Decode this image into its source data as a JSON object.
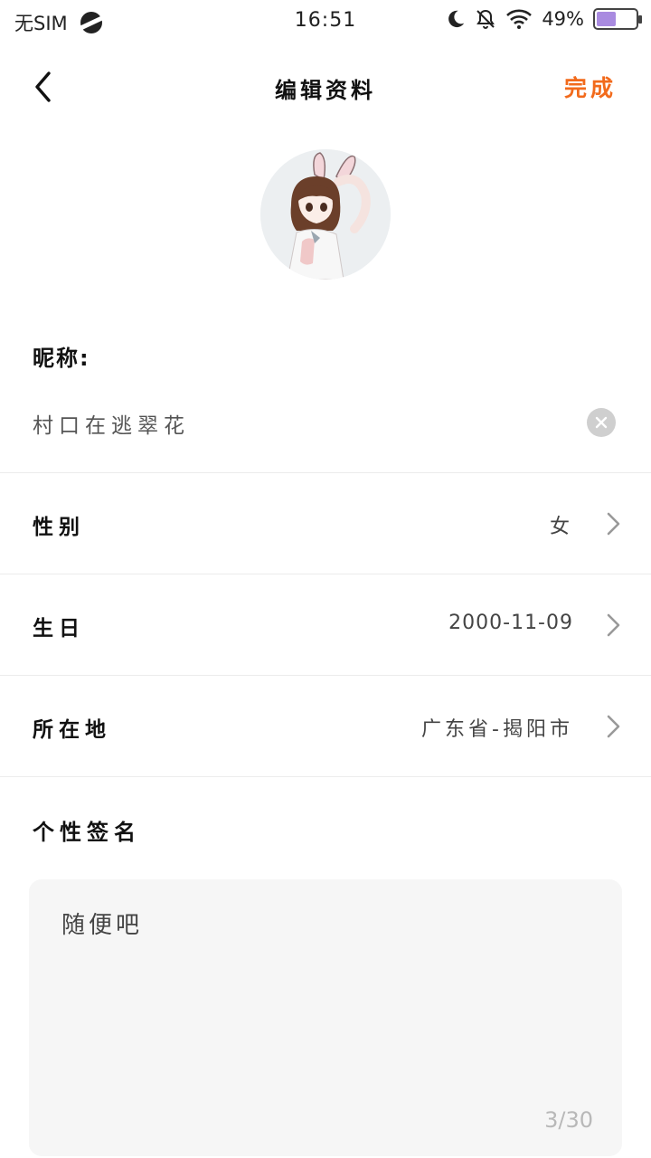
{
  "status_bar": {
    "carrier": "无SIM",
    "time": "16:51",
    "battery": "49%",
    "battery_level": 0.49,
    "icons": [
      "planet-icon",
      "moon-icon",
      "mute-bell-icon",
      "wifi-icon",
      "battery-icon"
    ]
  },
  "header": {
    "title": "编辑资料",
    "done_label": "完成"
  },
  "form": {
    "nickname_label": "昵称:",
    "nickname_value": "村口在逃翠花",
    "gender_label": "性别",
    "gender_value": "女",
    "birthday_label": "生日",
    "birthday_value": "2000-11-09",
    "location_label": "所在地",
    "location_value": "广东省-揭阳市",
    "signature_label": "个性签名",
    "signature_value": "随便吧",
    "signature_count": "3/30"
  },
  "colors": {
    "accent": "#f26a1b",
    "battery_fill": "#a98be0",
    "signature_bg": "#f6f6f6"
  }
}
